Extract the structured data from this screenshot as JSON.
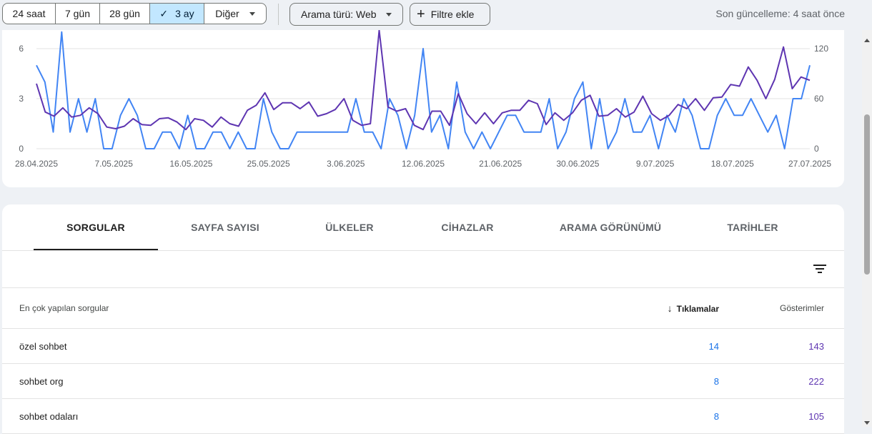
{
  "toolbar": {
    "ranges": [
      {
        "label": "24 saat",
        "selected": false
      },
      {
        "label": "7 gün",
        "selected": false
      },
      {
        "label": "28 gün",
        "selected": false
      },
      {
        "label": "3 ay",
        "selected": true
      },
      {
        "label": "Diğer",
        "selected": false
      }
    ],
    "search_type": "Arama türü: Web",
    "add_filter": "Filtre ekle",
    "last_update": "Son güncelleme: 4 saat önce"
  },
  "chart_data": {
    "type": "line",
    "x_tick_labels": [
      "28.04.2025",
      "7.05.2025",
      "16.05.2025",
      "25.05.2025",
      "3.06.2025",
      "12.06.2025",
      "21.06.2025",
      "30.06.2025",
      "9.07.2025",
      "18.07.2025",
      "27.07.2025"
    ],
    "y_left_ticks": [
      "0",
      "3",
      "6"
    ],
    "y_right_ticks": [
      "0",
      "60",
      "120"
    ],
    "ylim_left": [
      0,
      6
    ],
    "ylim_right": [
      0,
      120
    ],
    "grid": true,
    "colors": {
      "clicks": "#4285f4",
      "impressions": "#5e35b1"
    },
    "series": [
      {
        "axis": "left",
        "values": [
          5,
          4,
          1,
          7,
          1,
          3,
          1,
          3,
          0,
          0,
          2,
          3,
          2,
          0,
          0,
          1,
          1,
          0,
          2,
          0,
          0,
          1,
          1,
          0,
          1,
          0,
          0,
          3,
          1,
          0,
          0,
          1,
          1,
          1,
          1,
          1,
          1,
          1,
          3,
          1,
          1,
          0,
          3,
          2,
          0,
          2,
          6,
          1,
          2,
          0,
          4,
          1,
          0,
          1,
          0,
          1,
          2,
          2,
          1,
          1,
          1,
          3,
          0,
          1,
          3,
          4,
          0,
          3,
          0,
          1,
          3,
          1,
          1,
          2,
          0,
          2,
          1,
          3,
          2,
          0,
          0,
          2,
          3,
          2,
          2,
          3,
          2,
          1,
          2,
          0,
          3,
          3,
          5
        ]
      },
      {
        "axis": "right",
        "values": [
          78,
          44,
          39,
          49,
          38,
          40,
          49,
          42,
          26,
          24,
          27,
          36,
          29,
          28,
          36,
          37,
          32,
          23,
          36,
          34,
          26,
          38,
          30,
          27,
          46,
          52,
          67,
          47,
          55,
          55,
          48,
          56,
          39,
          42,
          47,
          60,
          34,
          28,
          30,
          142,
          50,
          45,
          48,
          28,
          23,
          45,
          45,
          28,
          66,
          42,
          30,
          43,
          30,
          43,
          46,
          46,
          58,
          54,
          29,
          43,
          34,
          43,
          58,
          64,
          39,
          40,
          48,
          38,
          44,
          63,
          42,
          34,
          40,
          53,
          48,
          60,
          46,
          61,
          62,
          77,
          75,
          98,
          82,
          60,
          83,
          122,
          72,
          86,
          82
        ]
      }
    ]
  },
  "tabs": [
    "SORGULAR",
    "SAYFA SAYISI",
    "ÜLKELER",
    "CİHAZLAR",
    "ARAMA GÖRÜNÜMÜ",
    "TARİHLER"
  ],
  "table": {
    "col_query": "En çok yapılan sorgular",
    "col_clicks": "Tıklamalar",
    "col_impressions": "Gösterimler",
    "rows": [
      {
        "query": "özel sohbet",
        "clicks": "14",
        "impressions": "143"
      },
      {
        "query": "sohbet org",
        "clicks": "8",
        "impressions": "222"
      },
      {
        "query": "sohbet odaları",
        "clicks": "8",
        "impressions": "105"
      }
    ]
  }
}
